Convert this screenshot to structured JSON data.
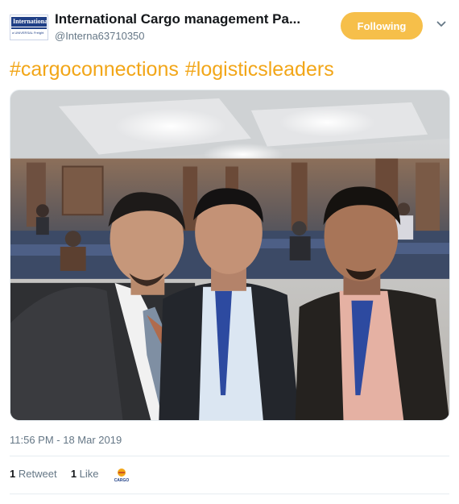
{
  "account": {
    "name": "International Cargo management Pa...",
    "handle": "@Interna63710350",
    "logo_text": "International C",
    "logo_subtext": "a UNIVERSAL Freight"
  },
  "follow_button": {
    "label": "Following",
    "color": "#f6bf4a"
  },
  "more_menu": {
    "icon": "chevron-down-icon"
  },
  "tweet": {
    "hashtags": [
      "#cargoconnections",
      "#logisticsleaders"
    ],
    "hashtag_color": "#f2a618",
    "timestamp": "11:56 PM - 18 Mar 2019"
  },
  "stats": {
    "retweets_count": "1",
    "retweets_label": "Retweet",
    "likes_count": "1",
    "likes_label": "Like",
    "liker_logo_text": "CARGO"
  }
}
